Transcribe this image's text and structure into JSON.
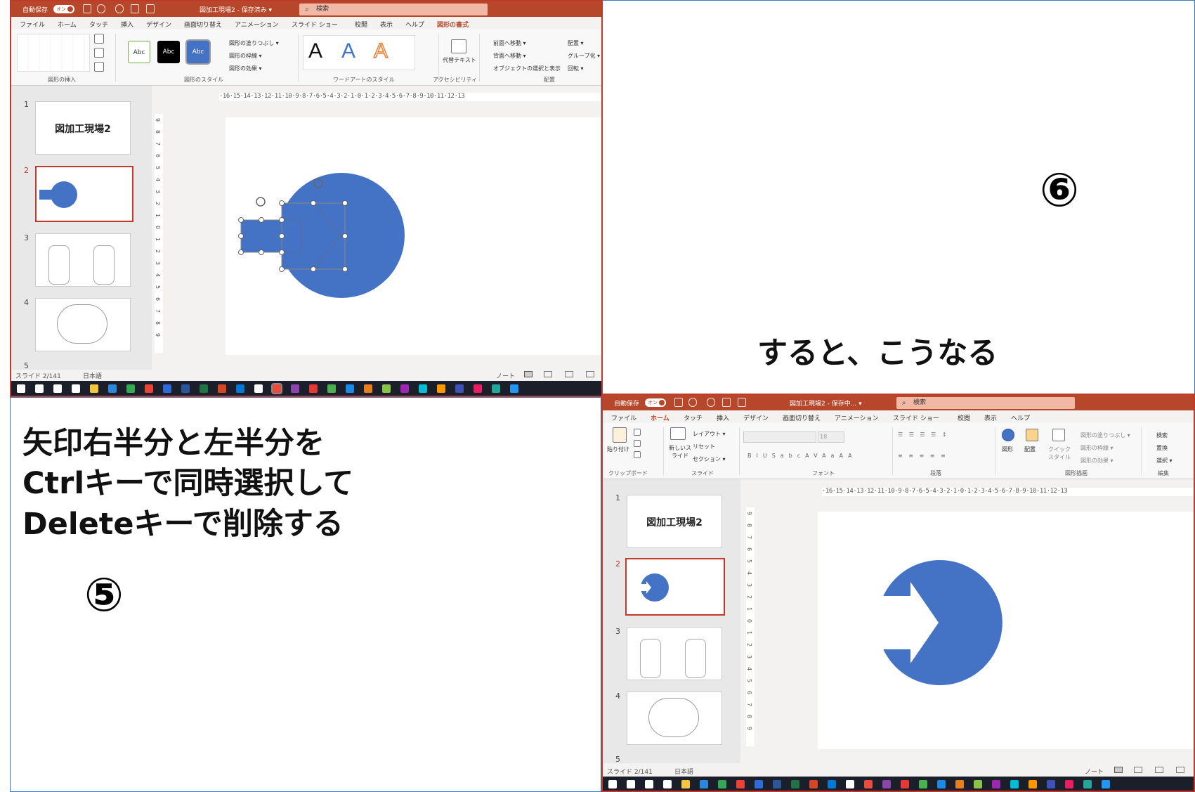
{
  "left_window": {
    "autosave": "自動保存",
    "autosave_toggle": "オン",
    "doc_title": "図加工現場2 - 保存済み ▾",
    "search": "検索",
    "tabs": [
      "ファイル",
      "ホーム",
      "タッチ",
      "挿入",
      "デザイン",
      "画面切り替え",
      "アニメーション",
      "スライド ショー",
      "校閲",
      "表示",
      "ヘルプ",
      "図形の書式"
    ],
    "active_tab": "図形の書式",
    "ribbon": {
      "g_insert": "図形の挿入",
      "g_style": "図形のスタイル",
      "g_wordart": "ワードアートのスタイル",
      "g_access": "アクセシビリティ",
      "g_arrange": "配置",
      "style_abc": "Abc",
      "fill": "図形の塗りつぶし ▾",
      "outline": "図形の枠線 ▾",
      "effect": "図形の効果 ▾",
      "alt_text": "代替テキスト",
      "front": "前面へ移動 ▾",
      "back": "背面へ移動 ▾",
      "selection": "オブジェクトの選択と表示",
      "align": "配置 ▾",
      "group": "グループ化 ▾",
      "rotate": "回転 ▾",
      "wa_letter": "A"
    },
    "ruler": "·16·15·14·13·12·11·10·9·8·7·6·5·4·3·2·1·0·1·2·3·4·5·6·7·8·9·10·11·12·13",
    "vruler": [
      "9",
      "8",
      "7",
      "6",
      "5",
      "4",
      "3",
      "2",
      "1",
      "0",
      "1",
      "2",
      "3",
      "4",
      "5",
      "6",
      "7",
      "8",
      "9"
    ],
    "slide_numbers": [
      "1",
      "2",
      "3",
      "4",
      "5"
    ],
    "slide1_title": "図加工現場2",
    "status_slide": "スライド 2/141",
    "status_lang": "日本語",
    "status_notes": "ノート"
  },
  "right_window": {
    "autosave": "自動保存",
    "autosave_toggle": "オン",
    "doc_title": "図加工現場2 - 保存中... ▾",
    "search": "検索",
    "tabs": [
      "ファイル",
      "ホーム",
      "タッチ",
      "挿入",
      "デザイン",
      "画面切り替え",
      "アニメーション",
      "スライド ショー",
      "校閲",
      "表示",
      "ヘルプ"
    ],
    "active_tab": "ホーム",
    "ribbon": {
      "paste": "貼り付け",
      "g_clipboard": "クリップボード",
      "new_slide": "新しいスライド",
      "layout": "レイアウト ▾",
      "reset": "リセット",
      "section": "セクション ▾",
      "g_slide": "スライド",
      "font_size": "18",
      "g_font": "フォント",
      "g_para": "段落",
      "shapes": "図形",
      "arrange": "配置",
      "quick": "クイックスタイル",
      "fill": "図形の塗りつぶし ▾",
      "outline": "図形の枠線 ▾",
      "effect": "図形の効果 ▾",
      "g_draw": "図形描画",
      "find": "検索",
      "replace": "置換",
      "select": "選択 ▾",
      "g_edit": "編集"
    },
    "ruler": "·16·15·14·13·12·11·10·9·8·7·6·5·4·3·2·1·0·1·2·3·4·5·6·7·8·9·10·11·12·13",
    "vruler": [
      "9",
      "8",
      "7",
      "6",
      "5",
      "4",
      "3",
      "2",
      "1",
      "0",
      "1",
      "2",
      "3",
      "4",
      "5",
      "6",
      "7",
      "8",
      "9"
    ],
    "slide_numbers": [
      "1",
      "2",
      "3",
      "4",
      "5"
    ],
    "slide1_title": "図加工現場2",
    "status_slide": "スライド 2/141",
    "status_lang": "日本語",
    "status_notes": "ノート"
  },
  "annotations": {
    "step5_line1": "矢印右半分と左半分を",
    "step5_line2": "Ctrlキーで同時選択して",
    "step5_line3": "Deleteキーで削除する",
    "step5_num": "⑤",
    "step6_num": "⑥",
    "step6_text": "すると、こうなる"
  },
  "colors": {
    "accent": "#b7472a",
    "shape": "#4472c4",
    "frame": "#3c78c0"
  }
}
